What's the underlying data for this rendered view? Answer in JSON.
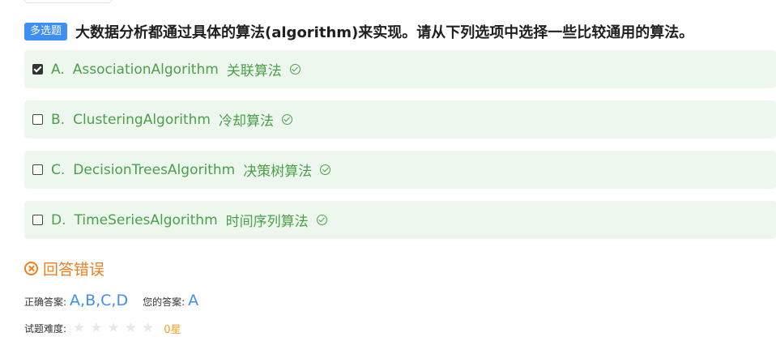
{
  "question": {
    "type_badge": "多选题",
    "text": "大数据分析都通过具体的算法(algorithm)来实现。请从下列选项中选择一些比较通用的算法。"
  },
  "options": [
    {
      "letter": "A.",
      "en": "AssociationAlgorithm",
      "cn": "关联算法",
      "checked": true,
      "correct": true
    },
    {
      "letter": "B.",
      "en": "ClusteringAlgorithm",
      "cn": "冷却算法",
      "checked": false,
      "correct": true
    },
    {
      "letter": "C.",
      "en": "DecisionTreesAlgorithm",
      "cn": "决策树算法",
      "checked": false,
      "correct": true
    },
    {
      "letter": "D.",
      "en": "TimeSeriesAlgorithm",
      "cn": "时间序列算法",
      "checked": false,
      "correct": true
    }
  ],
  "result": {
    "status_icon": "close-circle-icon",
    "text": "回答错误"
  },
  "answers": {
    "correct_label": "正确答案:",
    "correct_value": "A,B,C,D",
    "yours_label": "您的答案:",
    "yours_value": "A"
  },
  "difficulty": {
    "label": "试题难度:",
    "stars_total": 5,
    "stars_filled": 0,
    "value_text": "0星"
  },
  "colors": {
    "badge": "#3d8ef5",
    "option_bg": "#eef7ee",
    "option_text": "#4aa04a",
    "wrong": "#f07f1d",
    "answer_value": "#3d8ef5",
    "star_text": "#f0a020"
  }
}
